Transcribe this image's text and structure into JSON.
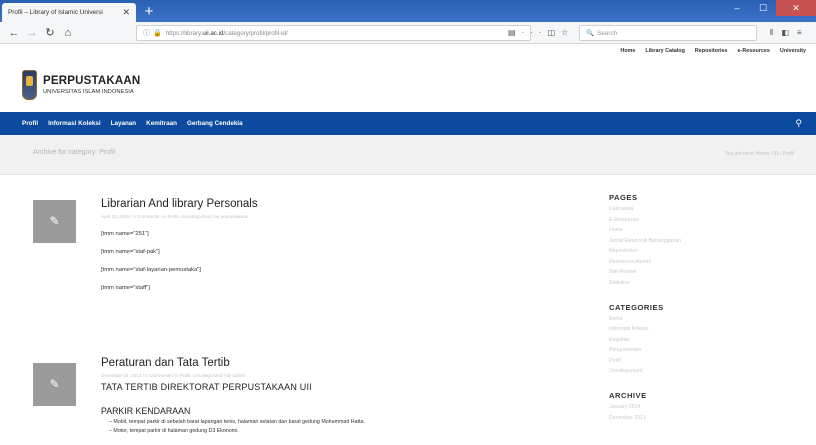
{
  "browser": {
    "tab_title": "Profil – Library of Islamic Universi",
    "tab_close": "✕",
    "new_tab": "+",
    "url_prefix": "https://library.",
    "url_host": "uii.ac.id",
    "url_path": "/category/profil/profil-id/",
    "search_placeholder": "Search"
  },
  "site": {
    "top_menu": [
      "Home",
      "Library Catalog",
      "Repositories",
      "e-Resources",
      "University"
    ],
    "brand_name": "PERPUSTAKAAN",
    "brand_sub": "UNIVERSITAS ISLAM INDONESIA",
    "main_nav": [
      "Profil",
      "Informasi Koleksi",
      "Layanan",
      "Kemitraan",
      "Gerbang Cendekia"
    ],
    "archive_title": "Archive for category: Profil",
    "breadcrumbs": "You are here: Home / ID / Profil"
  },
  "posts": [
    {
      "title": "Librarian And library Personals",
      "meta": "April 10, 2015 / 0 Comments / in Profil, Uncategorized / by perpustakaan",
      "lines": [
        "[tmm name=\"251\"]",
        "[tmm name=\"staf-pak\"]",
        "[tmm name=\"staf-layanan-pemustaka\"]",
        "[tmm name=\"staff\"]"
      ]
    },
    {
      "title": "Peraturan dan Tata Tertib",
      "meta": "December 16, 2013 / 0 Comments / in Profil, Uncategorized / by admin",
      "heading": "TATA TERTIB DIREKTORAT PERPUSTAKAAN UII",
      "subheading": "PARKIR KENDARAAN",
      "bullets": [
        "Mobil, tempat parkir di sebelah barat lapangan tenis, halaman selatan dan barat gedung Mohammad Hatta.",
        "Motor, tempat parkir di halaman gedung D3 Ekonomi."
      ]
    }
  ],
  "sidebar": {
    "pages_title": "PAGES",
    "pages": [
      "Cakrawala",
      "E-Resources",
      "Home",
      "Jurnal Elektronik Berlangganan",
      "Repositories",
      "Resources Alumni",
      "Site Review",
      "Statistics"
    ],
    "categories_title": "CATEGORIES",
    "categories": [
      "Berita",
      "Informasi Koleksi",
      "Kegiatan",
      "Pengumuman",
      "Profil",
      "Uncategorized"
    ],
    "archive_title": "ARCHIVE",
    "archives": [
      "January 2014",
      "December 2013"
    ]
  }
}
